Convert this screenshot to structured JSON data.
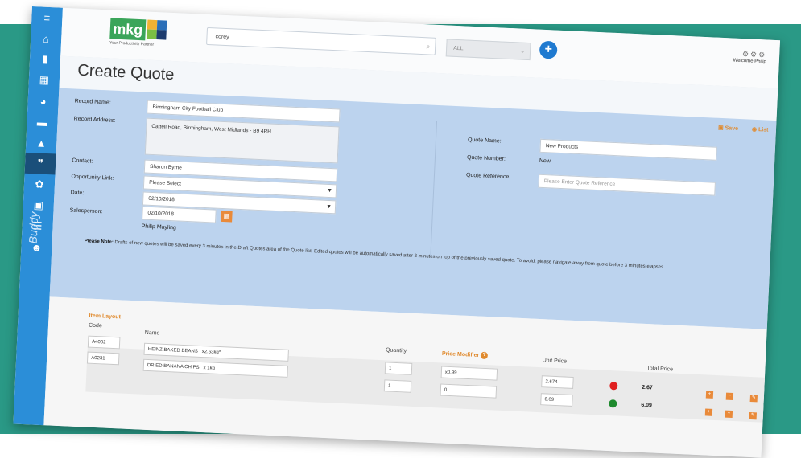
{
  "app": {
    "logo_text": "mkg",
    "logo_tagline": "Your Productivity Partner",
    "brand_vertical": "Buddy",
    "search_value": "corey",
    "filter_value": "ALL",
    "welcome_text": "Welcome Philip"
  },
  "sidebar": {
    "items": [
      {
        "icon": "menu-icon",
        "glyph": "≡"
      },
      {
        "icon": "home-icon",
        "glyph": "⌂"
      },
      {
        "icon": "document-icon",
        "glyph": "▮"
      },
      {
        "icon": "calendar-icon",
        "glyph": "▦"
      },
      {
        "icon": "pie-chart-icon",
        "glyph": "◕"
      },
      {
        "icon": "briefcase-icon",
        "glyph": "▬"
      },
      {
        "icon": "flask-icon",
        "glyph": "▲"
      },
      {
        "icon": "quote-icon",
        "glyph": "❞"
      },
      {
        "icon": "handshake-icon",
        "glyph": "✿"
      },
      {
        "icon": "lock-icon",
        "glyph": "▣"
      },
      {
        "icon": "list-icon",
        "glyph": "☰"
      },
      {
        "icon": "users-icon",
        "glyph": "☻"
      }
    ],
    "active_index": 7
  },
  "page": {
    "title": "Create Quote"
  },
  "form": {
    "record_name_label": "Record Name:",
    "record_name_value": "Birmingham City Football Club",
    "record_address_label": "Record Address:",
    "record_address_value": "Cattell Road, Birmingham, West Midlands - B9 4RH",
    "contact_label": "Contact:",
    "contact_value": "Sharon Byrne",
    "opportunity_label": "Opportunity Link:",
    "opportunity_value": "Please Select",
    "date_label": "Date:",
    "date_value": "02/10/2018",
    "salesperson_label": "Salesperson:",
    "salesperson_value": "Philip Mayling",
    "quote_name_label": "Quote Name:",
    "quote_name_value": "New Products",
    "quote_number_label": "Quote Number:",
    "quote_number_value": "New",
    "quote_reference_label": "Quote Reference:",
    "quote_reference_placeholder": "Please Enter Quote Reference",
    "save_label": "Save",
    "list_label": "List",
    "note_prefix": "Please Note:",
    "note_text": "Drafts of new quotes will be saved every 3 minutes in the Draft Quotes area of the Quote list. Edited quotes will be automatically saved after 3 minutes on top of the previously saved quote. To avoid, please navigate away from quote before 3 minutes elapses."
  },
  "lines": {
    "section_title": "Item Layout",
    "headers": {
      "code": "Code",
      "name": "Name",
      "quantity": "Quantity",
      "price_modifier": "Price Modifier",
      "unit_price": "Unit Price",
      "total_price": "Total Price"
    },
    "rows": [
      {
        "code": "A4002",
        "name": "HEINZ BAKED BEANS",
        "size": "x2.63kg*",
        "quantity": "1",
        "modifier": "x0.99",
        "unit_price": "2.674",
        "status_color": "#e02020",
        "total": "2.67"
      },
      {
        "code": "A0231",
        "name": "DRIED BANANA CHIPS",
        "size": "x 1kg",
        "quantity": "1",
        "modifier": "0",
        "unit_price": "6.09",
        "status_color": "#1e8a2e",
        "total": "6.09"
      }
    ]
  },
  "colors": {
    "accent": "#2b8ed8",
    "orange": "#e98a3a",
    "teal_background": "#2a9986",
    "form_panel": "#bcd3ee"
  }
}
